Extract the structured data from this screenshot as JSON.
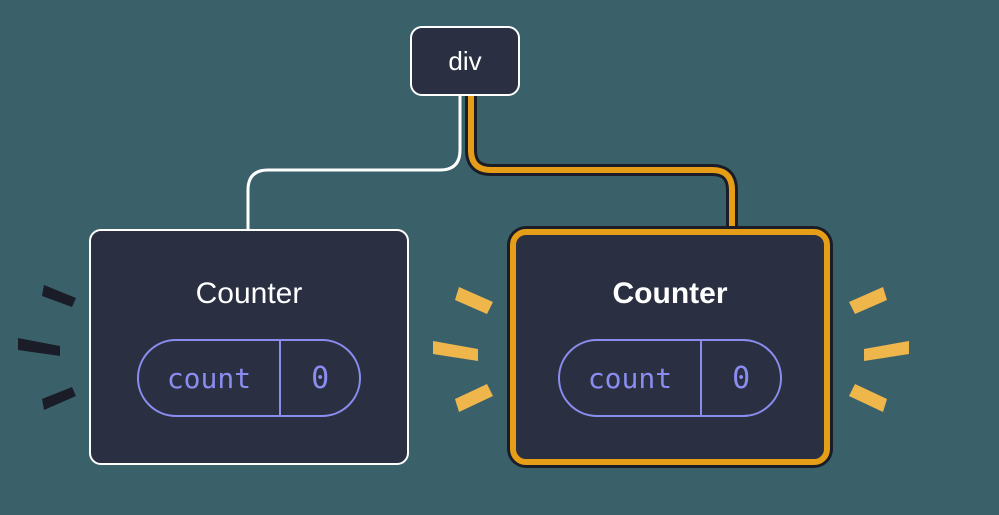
{
  "root": {
    "label": "div"
  },
  "counters": {
    "left": {
      "title": "Counter",
      "state_label": "count",
      "state_value": "0"
    },
    "right": {
      "title": "Counter",
      "state_label": "count",
      "state_value": "0"
    }
  },
  "colors": {
    "highlight": "#e69d17",
    "outline": "#ffffff",
    "dark_accent": "#1a1d27",
    "pill": "#8a8cf0"
  }
}
